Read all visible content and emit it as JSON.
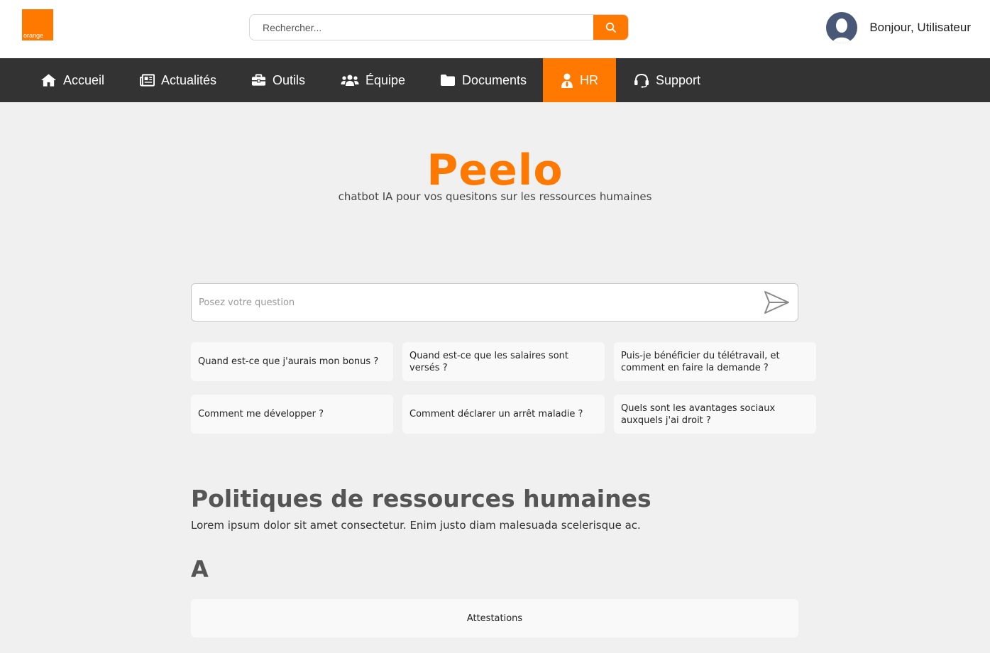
{
  "header": {
    "logo_text": "orange",
    "search_placeholder": "Rechercher...",
    "greeting": "Bonjour, Utilisateur"
  },
  "nav": {
    "items": [
      {
        "label": "Accueil",
        "icon": "home-icon"
      },
      {
        "label": "Actualités",
        "icon": "newspaper-icon"
      },
      {
        "label": "Outils",
        "icon": "toolbox-icon"
      },
      {
        "label": "Équipe",
        "icon": "users-icon"
      },
      {
        "label": "Documents",
        "icon": "folder-icon"
      },
      {
        "label": "HR",
        "icon": "user-tie-icon",
        "active": true
      },
      {
        "label": "Support",
        "icon": "headset-icon"
      }
    ]
  },
  "hero": {
    "title": "Peelo",
    "subtitle": "chatbot IA pour vos quesitons sur les ressources humaines"
  },
  "chat": {
    "placeholder": "Posez votre question"
  },
  "suggestions": [
    "Quand est-ce que j'aurais mon bonus ?",
    "Quand est-ce que les salaires sont versés ?",
    "Puis-je bénéficier du télétravail, et comment en faire la demande ?",
    "Comment me développer ?",
    "Comment déclarer un arrêt maladie ?",
    "Quels sont les avantages sociaux auxquels j'ai droit ?"
  ],
  "policies": {
    "title": "Politiques de ressources humaines",
    "description": "Lorem ipsum dolor sit amet consectetur. Enim justo diam malesuada scelerisque ac.",
    "letter": "A",
    "items": [
      "Attestations"
    ]
  },
  "colors": {
    "accent": "#ff7900",
    "nav_bg": "#333333",
    "page_bg": "#f0f0f0"
  }
}
